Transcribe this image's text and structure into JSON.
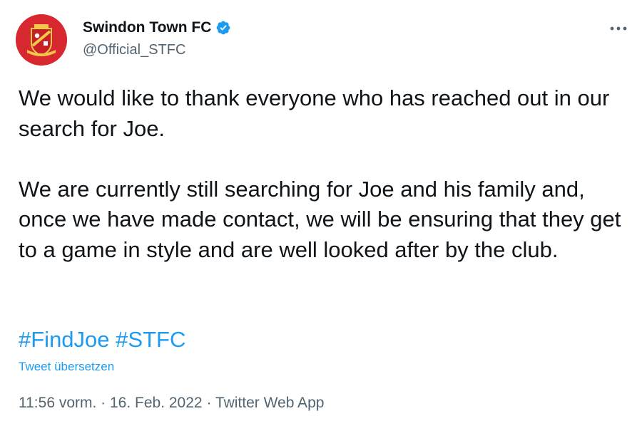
{
  "author": {
    "display_name": "Swindon Town FC",
    "handle": "@Official_STFC",
    "verified": true,
    "avatar_icon": "swindon-town-crest-icon",
    "avatar_color": "#d7282f"
  },
  "tweet": {
    "paragraphs": [
      "We would like to thank everyone who has reached out in our search for Joe.",
      "We are currently still searching for Joe and his family and, once we have made contact, we will be ensuring that they get to a game in style and are well looked after by the club."
    ],
    "hashtags": [
      "#FindJoe",
      "#STFC"
    ],
    "translate_label": "Tweet übersetzen"
  },
  "meta": {
    "time": "11:56 vorm.",
    "separator": " · ",
    "date": "16. Feb. 2022",
    "source": "Twitter Web App"
  },
  "colors": {
    "link": "#1d9bf0",
    "secondary_text": "#536471",
    "primary_text": "#0f1419"
  },
  "icons": {
    "verified": "verified-badge-icon",
    "more": "more-options-icon"
  }
}
